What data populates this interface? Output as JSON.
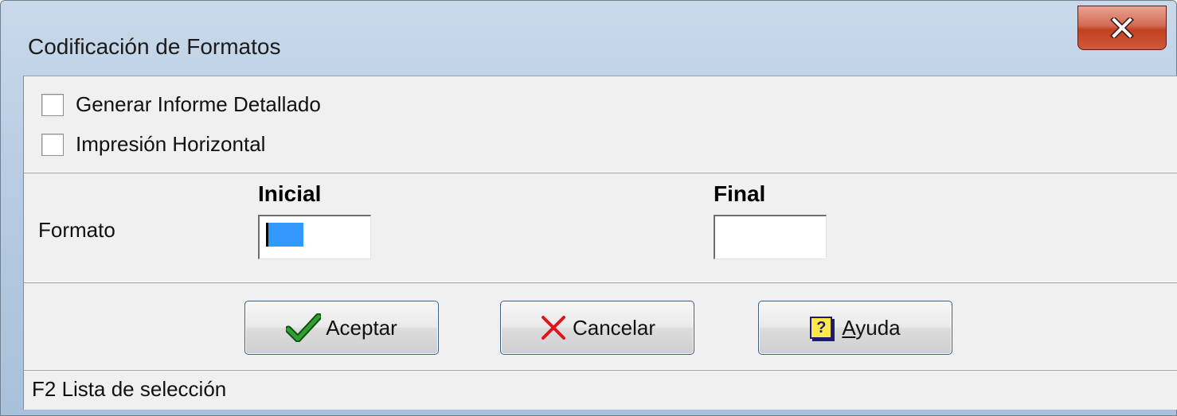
{
  "window": {
    "title": "Codificación de Formatos",
    "close_icon": "close-icon"
  },
  "options": {
    "detailed_report": {
      "label": "Generar Informe Detallado",
      "checked": false
    },
    "horizontal_print": {
      "label": "Impresión Horizontal",
      "checked": false
    }
  },
  "format": {
    "row_label": "Formato",
    "initial_header": "Inicial",
    "final_header": "Final",
    "initial_value": "",
    "final_value": ""
  },
  "buttons": {
    "accept": {
      "label": "Aceptar",
      "icon": "checkmark-icon"
    },
    "cancel": {
      "label": "Cancelar",
      "icon": "x-mark-icon"
    },
    "help": {
      "label": "Ayuda",
      "icon": "help-icon",
      "icon_glyph": "?"
    }
  },
  "status": {
    "text": "F2 Lista de selección"
  },
  "colors": {
    "selection": "#3399ff",
    "accept_icon": "#1f8a1f",
    "cancel_icon": "#e0141c",
    "help_icon_bg": "#ffe94a"
  }
}
